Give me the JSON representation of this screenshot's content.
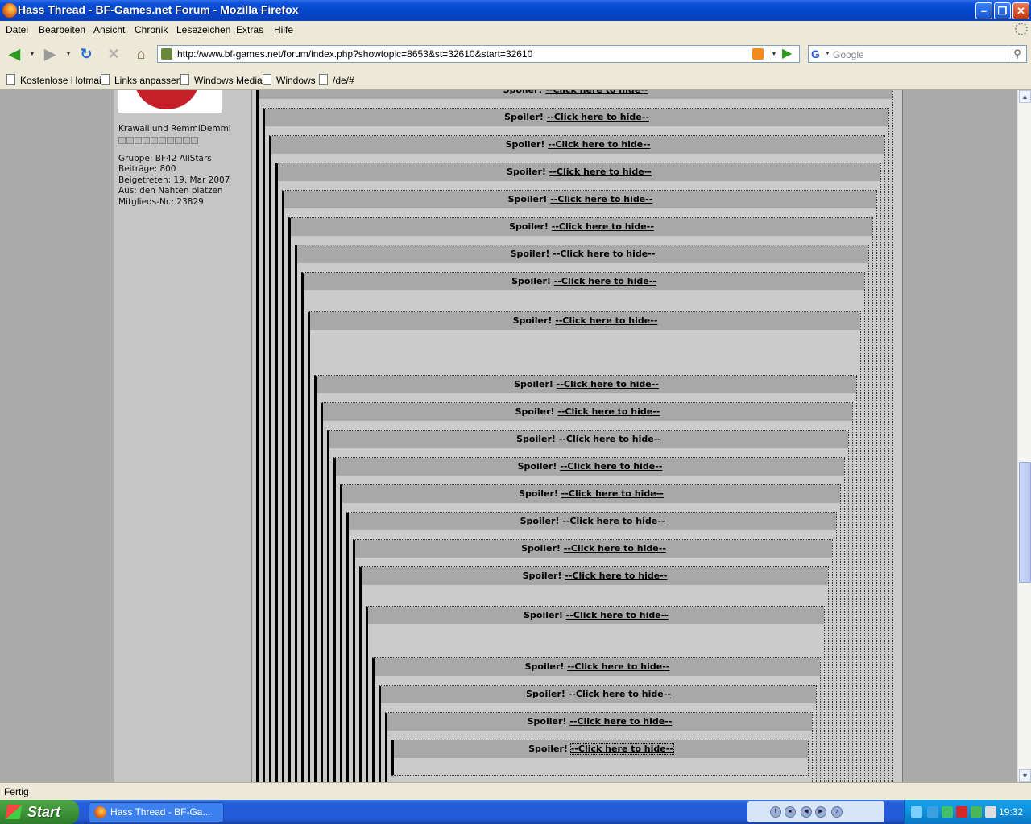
{
  "window": {
    "title": "Hass Thread - BF-Games.net Forum - Mozilla Firefox"
  },
  "menu": [
    "Datei",
    "Bearbeiten",
    "Ansicht",
    "Chronik",
    "Lesezeichen",
    "Extras",
    "Hilfe"
  ],
  "nav": {
    "url": "http://www.bf-games.net/forum/index.php?showtopic=8653&st=32610&start=32610",
    "search_placeholder": "Google"
  },
  "bookmarks": [
    "Kostenlose Hotmail",
    "Links anpassen",
    "Windows Media",
    "Windows",
    "/de/#"
  ],
  "profile": {
    "title": "Krawall und RemmiDemmi",
    "group": "Gruppe: BF42 AllStars",
    "posts": "Beiträge: 800",
    "joined": "Beigetreten: 19. Mar 2007",
    "location": "Aus: den Nähten platzen",
    "member_no": "Mitglieds-Nr.: 23829"
  },
  "spoiler": {
    "label": "Spoiler!",
    "link": "--Click here to hide--"
  },
  "status": "Fertig",
  "taskbar": {
    "start": "Start",
    "window_item": "Hass Thread - BF-Ga...",
    "clock": "19:32"
  }
}
